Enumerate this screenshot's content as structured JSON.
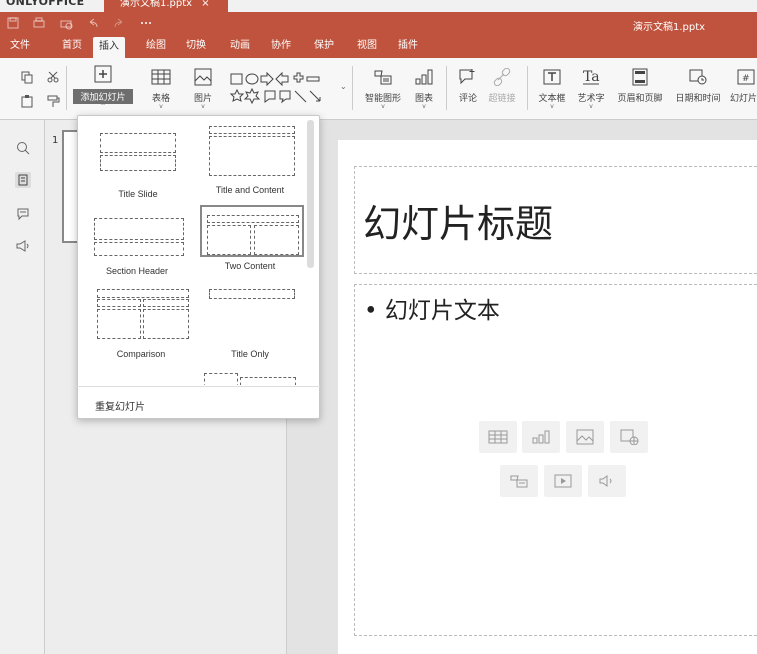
{
  "app": {
    "logo_text": "ONLYOFFICE",
    "tab_label": "演示文稿1.pptx",
    "tab_close": "×",
    "title": "演示文稿1.pptx"
  },
  "menu": {
    "items": [
      "文件",
      "首页",
      "插入",
      "绘图",
      "切换",
      "动画",
      "协作",
      "保护",
      "视图",
      "插件"
    ],
    "active": "插入"
  },
  "ribbon": {
    "add_slide": "添加幻灯片",
    "table": "表格",
    "image": "图片",
    "smartart": "智能图形",
    "chart": "图表",
    "comment": "评论",
    "hyperlink": "超链接",
    "textbox": "文本框",
    "textart": "艺术字",
    "header_footer": "页眉和页脚",
    "datetime": "日期和时间",
    "slide_number": "幻灯片"
  },
  "thumbs": {
    "slide_number": "1"
  },
  "slide": {
    "title": "幻灯片标题",
    "body": "• 幻灯片文本"
  },
  "layouts": [
    {
      "name": "Title Slide"
    },
    {
      "name": "Title and Content"
    },
    {
      "name": "Section Header"
    },
    {
      "name": "Two Content",
      "selected": true
    },
    {
      "name": "Comparison"
    },
    {
      "name": "Title Only"
    }
  ],
  "dropdown": {
    "duplicate": "重复幻灯片"
  },
  "colors": {
    "accent": "#c0533d",
    "ribbon_bg": "#f7f7f7"
  }
}
